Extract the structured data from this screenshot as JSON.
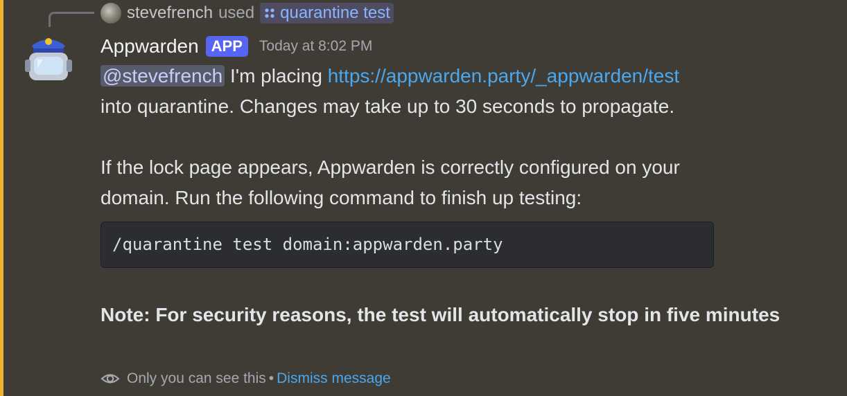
{
  "reply": {
    "username": "stevefrench",
    "used_text": "used",
    "command_name": "quarantine test",
    "avatar_icon": "user-avatar"
  },
  "message": {
    "author": "Appwarden",
    "tag": "APP",
    "timestamp": "Today at 8:02 PM",
    "avatar_icon": "police-robot-avatar",
    "mention": "@stevefrench",
    "text_before_link": " I'm placing ",
    "link": "https://appwarden.party/_appwarden/test",
    "line2": "into quarantine. Changes may take up to 30 seconds to propagate.",
    "line3": "If the lock page appears, Appwarden is correctly configured on your",
    "line4": "domain. Run the following command to finish up testing:",
    "code": "/quarantine test domain:appwarden.party",
    "note": "Note: For security reasons, the test will automatically stop in five minutes"
  },
  "ephemeral": {
    "icon": "eye-icon",
    "text": "Only you can see this",
    "separator": "•",
    "dismiss_label": "Dismiss message"
  },
  "colors": {
    "background": "#3f3c35",
    "mention_bar": "#f0b232",
    "link": "#4aa8f0",
    "app_tag": "#5865f2"
  }
}
